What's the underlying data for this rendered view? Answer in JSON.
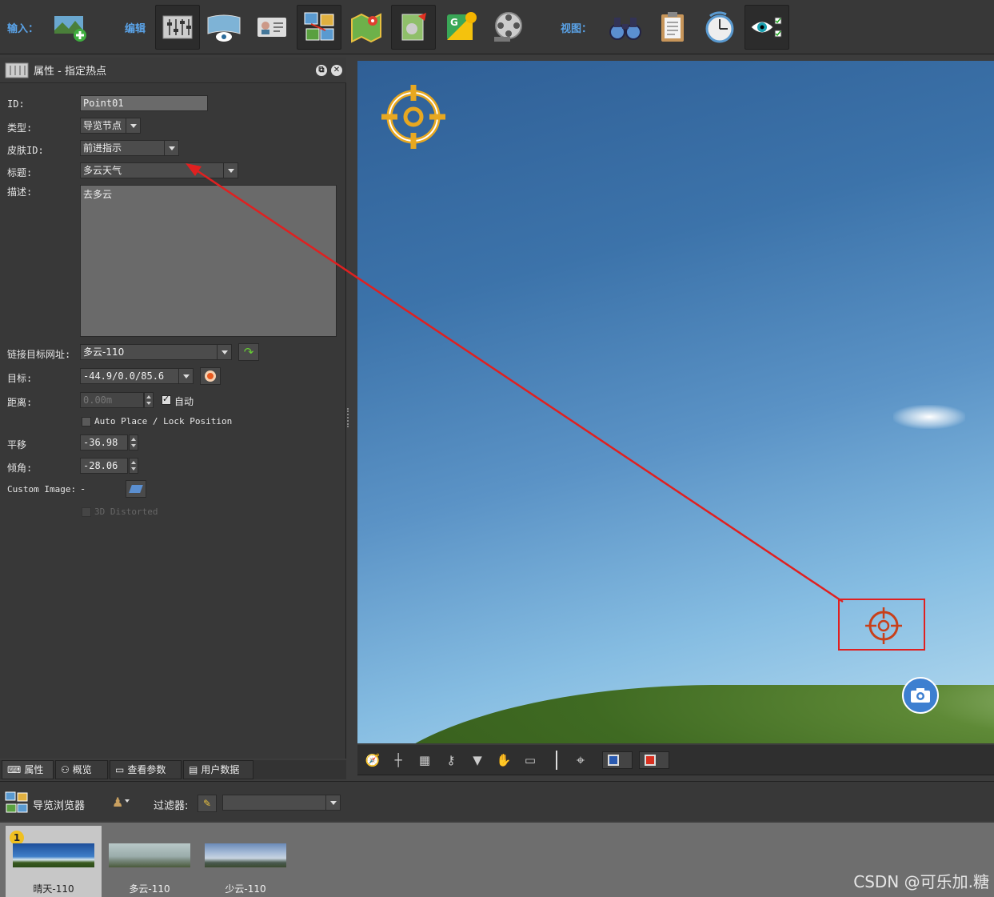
{
  "toolbar": {
    "input_label": "输入：",
    "edit_label": "编辑",
    "view_label": "视图：",
    "icons": [
      "add-panorama",
      "properties",
      "panorama-view",
      "user-data",
      "tour-browser",
      "map",
      "skin",
      "google-maps",
      "video",
      "binoculars",
      "clipboard",
      "timer",
      "eye-check"
    ]
  },
  "panel": {
    "title": "属性 - 指定热点",
    "id_label": "ID:",
    "id_value": "Point01",
    "type_label": "类型:",
    "type_value": "导览节点",
    "skin_label": "皮肤ID:",
    "skin_value": "前进指示",
    "title_label": "标题:",
    "title_value": "多云天气",
    "desc_label": "描述:",
    "desc_value": "去多云",
    "link_label": "链接目标网址:",
    "link_value": "多云-110",
    "target_label": "目标:",
    "target_value": "-44.9/0.0/85.6",
    "distance_label": "距离:",
    "distance_value": "0.00m",
    "auto_label": "自动",
    "autoplace_label": "Auto Place / Lock Position",
    "pan_label": "平移",
    "pan_value": "-36.98",
    "tilt_label": "倾角:",
    "tilt_value": "-28.06",
    "custom_image_label": "Custom Image:",
    "custom_image_value": "-",
    "distorted_label": "3D Distorted"
  },
  "tabs": [
    {
      "label": "属性"
    },
    {
      "label": "概览"
    },
    {
      "label": "查看参数"
    },
    {
      "label": "用户数据"
    }
  ],
  "tour": {
    "title": "导览浏览器",
    "filter_label": "过滤器:",
    "filter_value": ""
  },
  "thumbnails": [
    {
      "caption": "晴天-110",
      "badge": "1",
      "selected": true
    },
    {
      "caption": "多云-110",
      "selected": false
    },
    {
      "caption": "少云-110",
      "selected": false
    }
  ],
  "watermark": "CSDN @可乐加.糖",
  "colors": {
    "accent": "#5aa3e8",
    "annotation": "#e02020",
    "hotspot": "#e0a020"
  }
}
